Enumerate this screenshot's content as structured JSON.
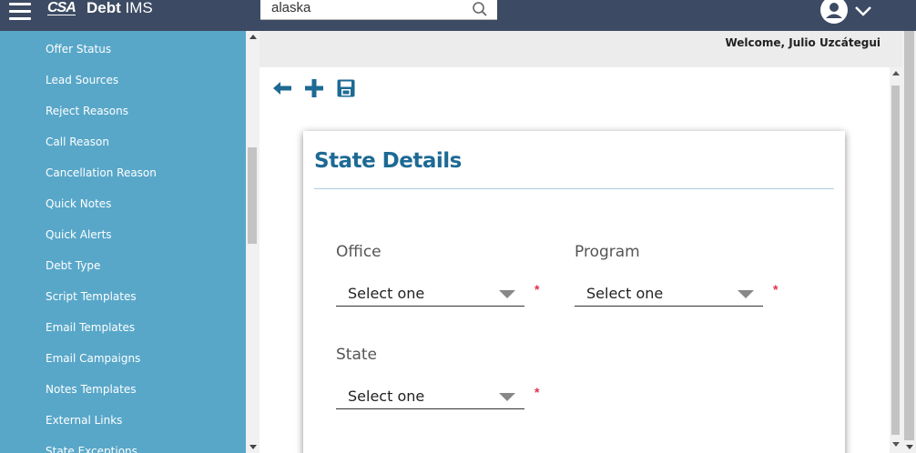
{
  "header": {
    "logo_text": "CSA",
    "app_name_bold": "Debt",
    "app_name_rest": " IMS",
    "search_value": "alaska",
    "icons": [
      "hamburger-menu-icon",
      "search-icon",
      "user-avatar-icon",
      "chevron-down-icon"
    ]
  },
  "sidebar": {
    "items": [
      {
        "label": "Offer Status"
      },
      {
        "label": "Lead Sources"
      },
      {
        "label": "Reject Reasons"
      },
      {
        "label": "Call Reason"
      },
      {
        "label": "Cancellation Reason"
      },
      {
        "label": "Quick Notes"
      },
      {
        "label": "Quick Alerts"
      },
      {
        "label": "Debt Type"
      },
      {
        "label": "Script Templates"
      },
      {
        "label": "Email Templates"
      },
      {
        "label": "Email Campaigns"
      },
      {
        "label": "Notes Templates"
      },
      {
        "label": "External Links"
      },
      {
        "label": "State Exceptions"
      }
    ]
  },
  "welcome_text": "Welcome, Julio Uzcátegui",
  "toolbar": {
    "icons": [
      "back-arrow-icon",
      "add-plus-icon",
      "save-disk-icon"
    ]
  },
  "form": {
    "title": "State Details",
    "office_label": "Office",
    "office_value": "Select one",
    "program_label": "Program",
    "program_value": "Select one",
    "state_label": "State",
    "state_value": "Select one",
    "required_marker": "*"
  },
  "colors": {
    "topbar": "#3c4a63",
    "sidebar": "#58a7c9",
    "accent": "#1d6a94",
    "required": "#e0314b"
  }
}
